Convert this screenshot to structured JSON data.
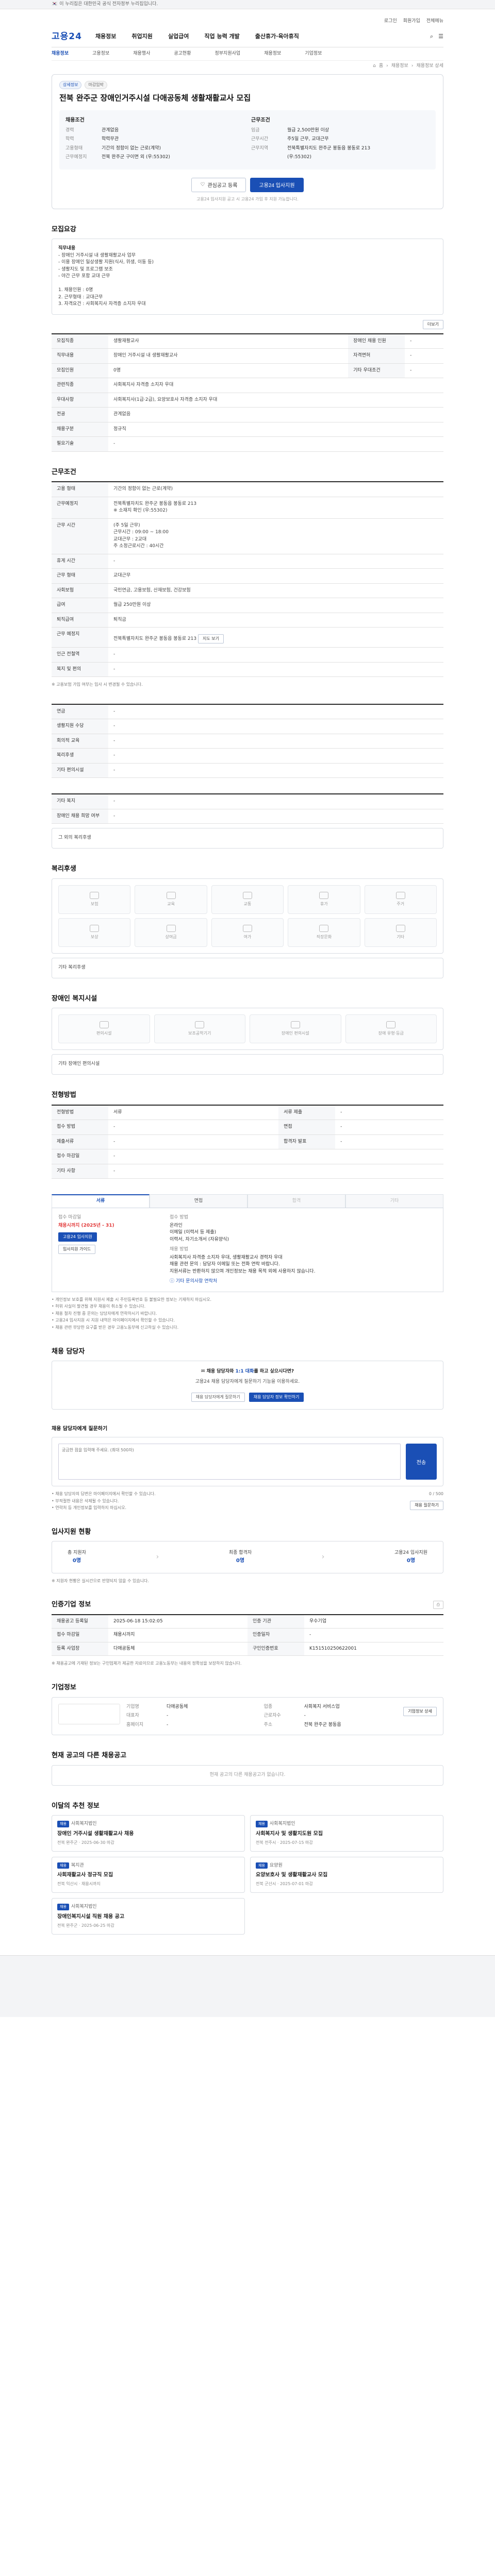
{
  "topbar": {
    "flag": "🇰🇷",
    "text": "이 누리집은 대한민국 공식 전자정부 누리집입니다."
  },
  "util": [
    "로그인",
    "회원가입",
    "전체메뉴"
  ],
  "header": {
    "logo": "고용24",
    "menu": [
      "채용정보",
      "취업지원",
      "실업급여",
      "직업 능력 개발",
      "출산휴가·육아휴직"
    ]
  },
  "subnav": [
    "채용정보",
    "고용정보",
    "채용행사",
    "공고현황",
    "정부지원사업",
    "채용정보",
    "기업정보"
  ],
  "breadcrumb": [
    "홈",
    "채용정보",
    "채용정보 상세"
  ],
  "job": {
    "chips": [
      "상세정보",
      "마감임박"
    ],
    "title": "전북 완주군 장애인거주시설 다애공동체 생활재활교사 모집",
    "left_title": "채용조건",
    "left": [
      [
        "경력",
        "관계없음"
      ],
      [
        "학력",
        "학력무관"
      ],
      [
        "고용형태",
        "기간의 정함이 없는 근로(계약)"
      ],
      [
        "근무예정지",
        "전북 완주군 구이면 외 (우:55302)"
      ]
    ],
    "right_title": "근무조건",
    "right": [
      [
        "임금",
        "월급 2,500만원 이상"
      ],
      [
        "근무시간",
        "주5일 근무, 교대근무"
      ],
      [
        "근무지역",
        "전북특별자치도 완주군 봉동읍 봉동로 213"
      ],
      [
        "",
        "(우:55302)"
      ]
    ]
  },
  "actions": {
    "scrap": "관심공고 등록",
    "apply": "고용24 입사지원"
  },
  "notice": "고용24 입사지원 공고 시 고용24 가입 후 지원 가능합니다.",
  "sections": {
    "task": "모집요강",
    "condition": "근무조건",
    "benefits": "복리후생",
    "disabled": "장애인 복지시설",
    "process": "전형방법",
    "chat": "채용 담당자",
    "qa": "채용 담당자에게 질문하기",
    "steps": "입사지원 현황",
    "info": "인증기업 정보",
    "company": "기업정보",
    "others": "현재 공고의 다른 채용공고",
    "recommend": "이달의 추천 정보"
  },
  "task_box": {
    "label": "직무내용",
    "body": "- 장애인 거주시설 내 생활재활교사 업무\n- 이용 장애인 일상생활 지원(식사, 위생, 이동 등)\n- 생활지도 및 프로그램 보조\n- 야간 근무 포함 교대 근무\n\n  1. 채용인원 : 0명\n  2. 근무형태 : 교대근무\n  3. 자격요건 : 사회복지사 자격증 소지자 우대",
    "more": "더보기"
  },
  "task_table": [
    [
      "모집직종",
      "생활재활교사"
    ],
    [
      "직무내용",
      "장애인 거주시설 내 생활재활교사"
    ],
    [
      "모집인원",
      "0명"
    ],
    [
      "관련직종",
      "사회복지사 자격증 소지자 우대"
    ],
    [
      "우대사항",
      "사회복지사(1급·2급), 요양보호사 자격증 소지자 우대"
    ],
    [
      "전공",
      "관계없음"
    ],
    [
      "채용구분",
      "정규직"
    ],
    [
      "필요기술",
      "-"
    ]
  ],
  "task_table_right": [
    [
      "장애인 채용 인원",
      "-"
    ],
    [
      "자격면허",
      "-"
    ],
    [
      "기타 우대조건",
      "-"
    ]
  ],
  "cond_table": [
    [
      "고용 형태",
      "기간의 정함이 없는 근로(계약)"
    ],
    [
      "근무예정지",
      "전북특별자치도 완주군 봉동읍 봉동로 213\n※ 소재지 확인 (우:55302)"
    ],
    [
      "근무 시간",
      "(주 5일 근무)\n근무시간 : 09:00 ~ 18:00\n교대근무 : 2교대\n주 소정근로시간 : 40시간"
    ],
    [
      "휴게 시간",
      "-"
    ],
    [
      "근무 형태",
      "교대근무"
    ],
    [
      "사회보험",
      "국민연금, 고용보험, 산재보험, 건강보험"
    ],
    [
      "급여",
      "월급 250만원 이상"
    ],
    [
      "퇴직급여",
      "퇴직금"
    ],
    [
      "근무 예정지",
      "전북특별자치도 완주군 봉동읍 봉동로 213"
    ],
    [
      "인근 전철역",
      "-"
    ],
    [
      "복지 및 편의",
      "-"
    ]
  ],
  "cond_note": "※ 고용보험 가입 여부는 입사 시 변경될 수 있습니다.",
  "cond_more": "지도 보기",
  "welfare_table": [
    [
      "연금",
      "-"
    ],
    [
      "생활지원 수당",
      "-"
    ],
    [
      "회의적 교육",
      "-"
    ],
    [
      "복리후생",
      "-"
    ],
    [
      "기타 편의시설",
      "-"
    ]
  ],
  "extra_table": [
    [
      "기타 복지",
      "-"
    ],
    [
      "장애인 채용 희망 여부",
      "-"
    ]
  ],
  "extra_note": "그 외의 복리후생",
  "benefit_items": [
    "보험",
    "교육",
    "교통",
    "휴가",
    "주거",
    "보상",
    "상여금",
    "여가",
    "직장문화",
    "기타"
  ],
  "benefit_empty": "기타 복리후생",
  "disabled_items": [
    "편의시설",
    "보조공학기기",
    "장애인 편의시설",
    "장애 유형·등급"
  ],
  "disabled_empty": "기타 장애인 편의시설",
  "process_table": [
    [
      "전형방법",
      "서류"
    ],
    [
      "접수 방법",
      "-"
    ],
    [
      "제출서류",
      "-"
    ],
    [
      "접수 마감일",
      "-"
    ],
    [
      "기타 사항",
      "-"
    ]
  ],
  "process_table_right": [
    [
      "서류 제출",
      "-"
    ],
    [
      "면접",
      "-"
    ],
    [
      "합격자 발표",
      "-"
    ]
  ],
  "apply_tabs": [
    "서류",
    "면접",
    "합격",
    "기타"
  ],
  "apply": {
    "left_label": "접수 마감일",
    "deadline": "채용시까지 (2025년 - 31)",
    "btn1": "고용24 입사지원",
    "btn2": "입사지원 가이드",
    "right_label": "접수 방법",
    "right_lines": [
      "온라인",
      "이메일 (이력서 등 제출)",
      "이력서, 자기소개서 (자유양식)",
      "채용 방법",
      "사회복지사 자격증 소지자 우대, 생활재활교사 경력자 우대",
      "채용 관련 문의 : 담당자 이메일 또는 전화 연락 바랍니다.",
      "지원서류는 반환하지 않으며 개인정보는 채용 목적 외에 사용하지 않습니다."
    ],
    "link": "기타 문의사항 연락처"
  },
  "apply_bullets": [
    "• 개인정보 보호를 위해 지원서 제출 시 주민등록번호 등 불필요한 정보는 기재하지 마십시오.",
    "• 허위 사실이 발견될 경우 채용이 취소될 수 있습니다.",
    "• 채용 절차 진행 중 문의는 담당자에게 연락하시기 바랍니다.",
    "• 고용24 입사지원 시 지원 내역은 마이페이지에서 확인할 수 있습니다.",
    "• 채용 관련 부당한 요구를 받은 경우 고용노동부에 신고하실 수 있습니다."
  ],
  "chat_box": {
    "title_pre": "채용 담당자와",
    "title_hl": "1:1 대화",
    "title_post": "를 하고 싶으시다면?",
    "desc": "고용24 채용 담당자에게 질문하기 기능을 이용하세요.",
    "b1": "채용 담당자에게 질문하기",
    "b2": "채용 담당자 정보 확인하기"
  },
  "qa": {
    "placeholder": "궁금한 점을 입력해 주세요. (최대 500자)",
    "send": "전송",
    "counter": "0 / 500",
    "bul": [
      "• 채용 담당자의 답변은 마이페이지에서 확인할 수 있습니다.",
      "• 부적절한 내용은 삭제될 수 있습니다.",
      "• 연락처 등 개인정보를 입력하지 마십시오."
    ],
    "btn": "채용 질문하기"
  },
  "steps": [
    [
      "총 지원자",
      "0명"
    ],
    [
      "최종 합격자",
      "0명"
    ],
    [
      "고용24 입사지원",
      "0명"
    ]
  ],
  "steps_note": "※ 지원자 현황은 실시간으로 반영되지 않을 수 있습니다.",
  "info_rows": [
    [
      "채용공고 등록일",
      "2025-06-18 15:02:05",
      "인증 기관",
      "우수기업"
    ],
    [
      "접수 마감일",
      "채용시까지",
      "인증일자",
      "-"
    ],
    [
      "등록 사업장",
      "다애공동체",
      "구인인증번호",
      "K151510250622001"
    ]
  ],
  "info_note": "※ 채용공고에 기재된 정보는 구인업체가 제공한 자료이므로 고용노동부는 내용의 정확성을 보장하지 않습니다.",
  "company": {
    "rows": [
      [
        "기업명",
        "다애공동체",
        "업종",
        "사회복지 서비스업"
      ],
      [
        "대표자",
        "-",
        "근로자수",
        "-"
      ],
      [
        "홈페이지",
        "-",
        "주소",
        "전북 완주군 봉동읍"
      ]
    ],
    "btn": "기업정보 상세"
  },
  "others_empty": "현재 공고의 다른 채용공고가 없습니다.",
  "recommend": [
    {
      "tag": "채용",
      "org": "사회복지법인",
      "title": "장애인 거주시설 생활재활교사 채용",
      "meta": "전북 완주군 · 2025-06-30 마감"
    },
    {
      "tag": "채용",
      "org": "사회복지법인",
      "title": "사회복지사 및 생활지도원 모집",
      "meta": "전북 전주시 · 2025-07-15 마감"
    },
    {
      "tag": "채용",
      "org": "복지관",
      "title": "사회재활교사 정규직 모집",
      "meta": "전북 익산시 · 채용시까지"
    },
    {
      "tag": "채용",
      "org": "요양원",
      "title": "요양보호사 및 생활재활교사 모집",
      "meta": "전북 군산시 · 2025-07-01 마감"
    },
    {
      "tag": "채용",
      "org": "사회복지법인",
      "title": "장애인복지시설 직원 채용 공고",
      "meta": "전북 완주군 · 2025-06-25 마감"
    }
  ]
}
